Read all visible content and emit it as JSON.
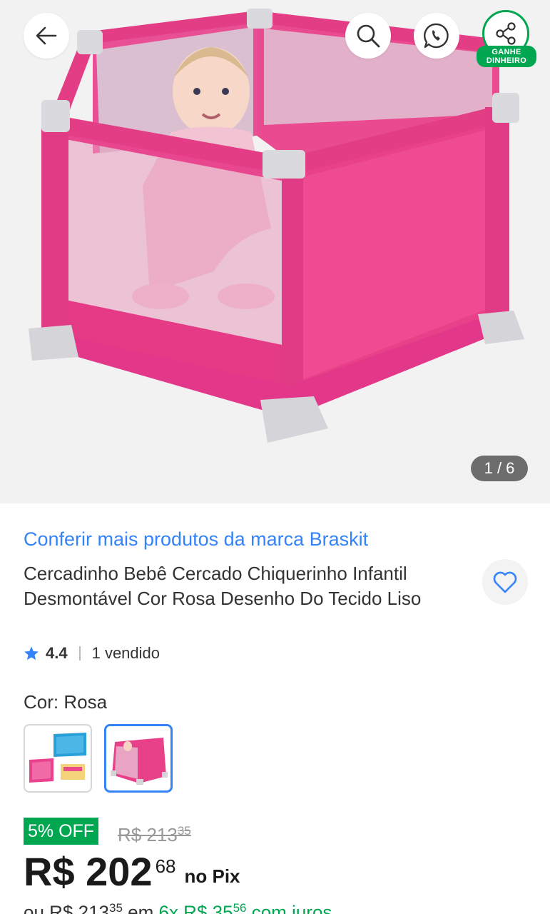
{
  "header": {
    "share_badge_line1": "GANHE",
    "share_badge_line2": "DINHEIRO"
  },
  "gallery": {
    "counter": "1 / 6"
  },
  "product": {
    "brand_link": "Conferir mais produtos da marca Braskit",
    "title": "Cercadinho Bebê Cercado Chiquerinho Infantil Desmontável Cor Rosa Desenho Do Tecido Liso",
    "rating": "4.4",
    "sold": "1 vendido",
    "color_label": "Cor:",
    "color_value": "Rosa"
  },
  "pricing": {
    "discount": "5% OFF",
    "old_price": "R$ 213",
    "old_cents": "35",
    "price": "R$ 202",
    "price_cents": "68",
    "price_suffix": "no Pix",
    "installments_prefix": "ou R$ 213",
    "installments_prefix_cents": "35",
    "installments_mid": " em ",
    "installments_green": "6x R$ 35",
    "installments_green_cents": "56",
    "installments_suffix": " com juros"
  },
  "colors": {
    "accent": "#3483fa",
    "green": "#00a650",
    "product_pink": "#ec4288"
  },
  "icons": [
    "arrow-left-icon",
    "search-icon",
    "whatsapp-icon",
    "share-icon",
    "heart-icon",
    "star-icon"
  ]
}
